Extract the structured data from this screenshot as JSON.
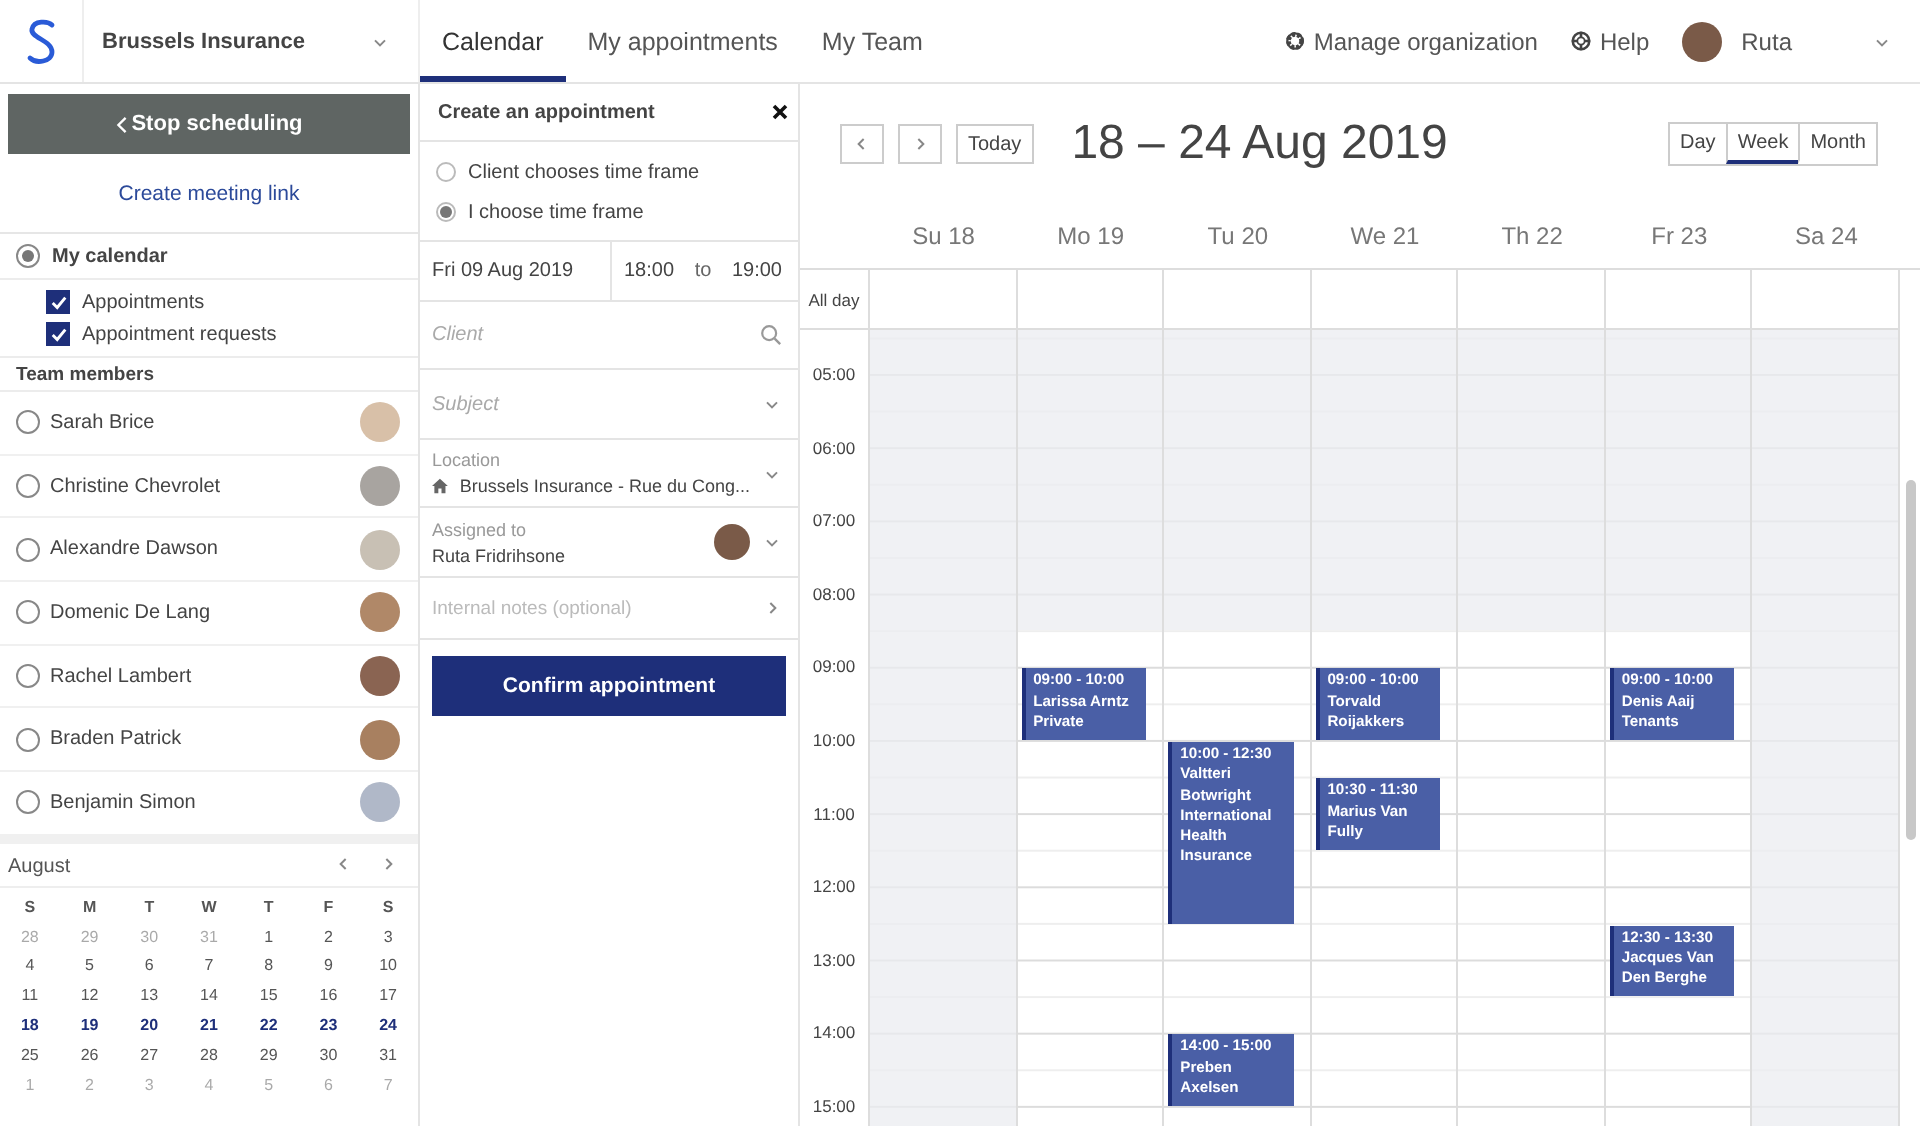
{
  "topbar": {
    "organization": "Brussels Insurance",
    "tabs": [
      {
        "label": "Calendar",
        "selected": true
      },
      {
        "label": "My appointments",
        "selected": false
      },
      {
        "label": "My Team",
        "selected": false
      }
    ],
    "manage": "Manage organization",
    "help": "Help",
    "user": "Ruta"
  },
  "sidebar": {
    "stop_button": "Stop scheduling",
    "meeting_link": "Create meeting link",
    "my_calendar": {
      "label": "My calendar",
      "selected": true
    },
    "filters": [
      {
        "label": "Appointments",
        "checked": true
      },
      {
        "label": "Appointment requests",
        "checked": true
      }
    ],
    "team_title": "Team members",
    "members": [
      {
        "name": "Sarah Brice",
        "selected": false
      },
      {
        "name": "Christine Chevrolet",
        "selected": false
      },
      {
        "name": "Alexandre Dawson",
        "selected": false
      },
      {
        "name": "Domenic De Lang",
        "selected": false
      },
      {
        "name": "Rachel Lambert",
        "selected": false
      },
      {
        "name": "Braden Patrick",
        "selected": false
      },
      {
        "name": "Benjamin Simon",
        "selected": false
      }
    ],
    "mini_calendar": {
      "month": "August",
      "weekdays": [
        "S",
        "M",
        "T",
        "W",
        "T",
        "F",
        "S"
      ],
      "weeks": [
        [
          {
            "d": "28",
            "muted": true,
            "selected": false
          },
          {
            "d": "29",
            "muted": true,
            "selected": false
          },
          {
            "d": "30",
            "muted": true,
            "selected": false
          },
          {
            "d": "31",
            "muted": true,
            "selected": false
          },
          {
            "d": "1",
            "muted": false,
            "selected": false
          },
          {
            "d": "2",
            "muted": false,
            "selected": false
          },
          {
            "d": "3",
            "muted": false,
            "selected": false
          }
        ],
        [
          {
            "d": "4",
            "muted": false,
            "selected": false
          },
          {
            "d": "5",
            "muted": false,
            "selected": false
          },
          {
            "d": "6",
            "muted": false,
            "selected": false
          },
          {
            "d": "7",
            "muted": false,
            "selected": false
          },
          {
            "d": "8",
            "muted": false,
            "selected": false
          },
          {
            "d": "9",
            "muted": false,
            "selected": false
          },
          {
            "d": "10",
            "muted": false,
            "selected": false
          }
        ],
        [
          {
            "d": "11",
            "muted": false,
            "selected": false
          },
          {
            "d": "12",
            "muted": false,
            "selected": false
          },
          {
            "d": "13",
            "muted": false,
            "selected": false
          },
          {
            "d": "14",
            "muted": false,
            "selected": false
          },
          {
            "d": "15",
            "muted": false,
            "selected": false
          },
          {
            "d": "16",
            "muted": false,
            "selected": false
          },
          {
            "d": "17",
            "muted": false,
            "selected": false
          }
        ],
        [
          {
            "d": "18",
            "muted": false,
            "selected": true
          },
          {
            "d": "19",
            "muted": false,
            "selected": true
          },
          {
            "d": "20",
            "muted": false,
            "selected": true
          },
          {
            "d": "21",
            "muted": false,
            "selected": true
          },
          {
            "d": "22",
            "muted": false,
            "selected": true
          },
          {
            "d": "23",
            "muted": false,
            "selected": true
          },
          {
            "d": "24",
            "muted": false,
            "selected": true
          }
        ],
        [
          {
            "d": "25",
            "muted": false,
            "selected": false
          },
          {
            "d": "26",
            "muted": false,
            "selected": false
          },
          {
            "d": "27",
            "muted": false,
            "selected": false
          },
          {
            "d": "28",
            "muted": false,
            "selected": false
          },
          {
            "d": "29",
            "muted": false,
            "selected": false
          },
          {
            "d": "30",
            "muted": false,
            "selected": false
          },
          {
            "d": "31",
            "muted": false,
            "selected": false
          }
        ],
        [
          {
            "d": "1",
            "muted": true,
            "selected": false
          },
          {
            "d": "2",
            "muted": true,
            "selected": false
          },
          {
            "d": "3",
            "muted": true,
            "selected": false
          },
          {
            "d": "4",
            "muted": true,
            "selected": false
          },
          {
            "d": "5",
            "muted": true,
            "selected": false
          },
          {
            "d": "6",
            "muted": true,
            "selected": false
          },
          {
            "d": "7",
            "muted": true,
            "selected": false
          }
        ]
      ]
    }
  },
  "form": {
    "title": "Create an appointment",
    "modes": [
      {
        "label": "Client chooses time frame",
        "selected": false
      },
      {
        "label": "I choose time frame",
        "selected": true
      }
    ],
    "date": "Fri 09 Aug 2019",
    "from": "18:00",
    "to_label": "to",
    "to": "19:00",
    "fields": [
      {
        "kind": "search",
        "placeholder": "Client"
      },
      {
        "kind": "select",
        "placeholder": "Subject"
      },
      {
        "kind": "location",
        "label": "Location",
        "value": "Brussels Insurance - Rue du Cong..."
      },
      {
        "kind": "person",
        "label": "Assigned to",
        "value": "Ruta Fridrihsone"
      },
      {
        "kind": "link",
        "placeholder": "Internal notes (optional)"
      }
    ],
    "confirm": "Confirm appointment"
  },
  "calendar": {
    "today": "Today",
    "range": "18 – 24 Aug 2019",
    "views": [
      {
        "label": "Day",
        "selected": false
      },
      {
        "label": "Week",
        "selected": true
      },
      {
        "label": "Month",
        "selected": false
      }
    ],
    "all_day": "All day",
    "hours": [
      "05:00",
      "06:00",
      "07:00",
      "08:00",
      "09:00",
      "10:00",
      "11:00",
      "12:00",
      "13:00",
      "14:00",
      "15:00"
    ],
    "days": [
      {
        "label": "Su 18",
        "closed": true
      },
      {
        "label": "Mo 19",
        "closed": false,
        "events": [
          {
            "time": "09:00 - 10:00",
            "client": "Larissa Arntz",
            "note": "Private"
          }
        ]
      },
      {
        "label": "Tu 20",
        "closed": false,
        "events": [
          {
            "time": "10:00 - 12:30",
            "client": "Valtteri Botwright",
            "note": "International Health Insurance"
          },
          {
            "time": "14:00 - 15:00",
            "client": "Preben Axelsen"
          }
        ]
      },
      {
        "label": "We 21",
        "closed": false,
        "events": [
          {
            "time": "09:00 - 10:00",
            "client": "Torvald Roijakkers"
          },
          {
            "time": "10:30 - 11:30",
            "client": "Marius Van Fully"
          }
        ]
      },
      {
        "label": "Th 22",
        "closed": false
      },
      {
        "label": "Fr 23",
        "closed": false,
        "events": [
          {
            "time": "09:00 - 10:00",
            "client": "Denis Aaij",
            "note": "Tenants"
          },
          {
            "time": "12:30 - 13:30",
            "client": "Jacques Van Den Berghe"
          }
        ]
      },
      {
        "label": "Sa 24",
        "closed": true
      }
    ]
  }
}
